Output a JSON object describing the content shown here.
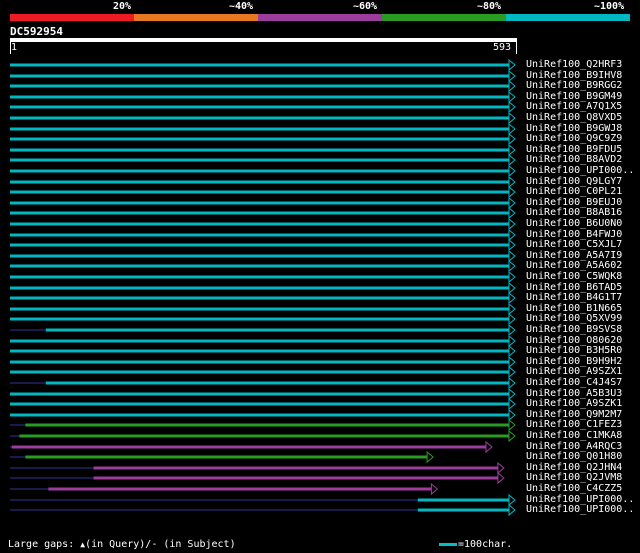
{
  "legend": {
    "labels": [
      "20%",
      "~40%",
      "~60%",
      "~80%",
      "~100%"
    ],
    "colors": [
      "#ed1c24",
      "#e87722",
      "#9c3d9e",
      "#2a9b23",
      "#00b8c2"
    ]
  },
  "query": {
    "id": "DC592954",
    "start": "1",
    "end": "593"
  },
  "hits": [
    {
      "label": "UniRef100_Q2HRF3",
      "color": "#00b8c2",
      "start": 1,
      "end": 593
    },
    {
      "label": "UniRef100_B9IHV8",
      "color": "#00b8c2",
      "start": 1,
      "end": 593
    },
    {
      "label": "UniRef100_B9RGG2",
      "color": "#00b8c2",
      "start": 1,
      "end": 593
    },
    {
      "label": "UniRef100_B9GM49",
      "color": "#00b8c2",
      "start": 1,
      "end": 593
    },
    {
      "label": "UniRef100_A7Q1X5",
      "color": "#00b8c2",
      "start": 1,
      "end": 593
    },
    {
      "label": "UniRef100_Q8VXD5",
      "color": "#00b8c2",
      "start": 1,
      "end": 593
    },
    {
      "label": "UniRef100_B9GWJ8",
      "color": "#00b8c2",
      "start": 1,
      "end": 593
    },
    {
      "label": "UniRef100_Q9C9Z9",
      "color": "#00b8c2",
      "start": 1,
      "end": 593
    },
    {
      "label": "UniRef100_B9FDU5",
      "color": "#00b8c2",
      "start": 1,
      "end": 593
    },
    {
      "label": "UniRef100_B8AVD2",
      "color": "#00b8c2",
      "start": 1,
      "end": 593
    },
    {
      "label": "UniRef100_UPI000..",
      "color": "#00b8c2",
      "start": 1,
      "end": 593
    },
    {
      "label": "UniRef100_Q9LGY7",
      "color": "#00b8c2",
      "start": 1,
      "end": 593
    },
    {
      "label": "UniRef100_C0PL21",
      "color": "#00b8c2",
      "start": 1,
      "end": 593
    },
    {
      "label": "UniRef100_B9EUJ0",
      "color": "#00b8c2",
      "start": 1,
      "end": 593
    },
    {
      "label": "UniRef100_B8AB16",
      "color": "#00b8c2",
      "start": 1,
      "end": 593
    },
    {
      "label": "UniRef100_B6U0N0",
      "color": "#00b8c2",
      "start": 1,
      "end": 593
    },
    {
      "label": "UniRef100_B4FWJ0",
      "color": "#00b8c2",
      "start": 1,
      "end": 593
    },
    {
      "label": "UniRef100_C5XJL7",
      "color": "#00b8c2",
      "start": 1,
      "end": 593
    },
    {
      "label": "UniRef100_A5A7I9",
      "color": "#00b8c2",
      "start": 1,
      "end": 593
    },
    {
      "label": "UniRef100_A5A602",
      "color": "#00b8c2",
      "start": 1,
      "end": 593
    },
    {
      "label": "UniRef100_C5WQK8",
      "color": "#00b8c2",
      "start": 1,
      "end": 593
    },
    {
      "label": "UniRef100_B6TAD5",
      "color": "#00b8c2",
      "start": 1,
      "end": 593
    },
    {
      "label": "UniRef100_B4G1T7",
      "color": "#00b8c2",
      "start": 1,
      "end": 593
    },
    {
      "label": "UniRef100_B1N665",
      "color": "#00b8c2",
      "start": 1,
      "end": 593
    },
    {
      "label": "UniRef100_Q5XV99",
      "color": "#00b8c2",
      "start": 1,
      "end": 593
    },
    {
      "label": "UniRef100_B9SVS8",
      "color": "#00b8c2",
      "start": 43,
      "end": 593
    },
    {
      "label": "UniRef100_O80620",
      "color": "#00b8c2",
      "start": 1,
      "end": 593
    },
    {
      "label": "UniRef100_B3H5R0",
      "color": "#00b8c2",
      "start": 1,
      "end": 593
    },
    {
      "label": "UniRef100_B9H9H2",
      "color": "#00b8c2",
      "start": 1,
      "end": 593
    },
    {
      "label": "UniRef100_A9SZX1",
      "color": "#00b8c2",
      "start": 1,
      "end": 593
    },
    {
      "label": "UniRef100_C4J4S7",
      "color": "#00b8c2",
      "start": 43,
      "end": 593
    },
    {
      "label": "UniRef100_A5B3U3",
      "color": "#00b8c2",
      "start": 1,
      "end": 593
    },
    {
      "label": "UniRef100_A9SZK1",
      "color": "#00b8c2",
      "start": 1,
      "end": 593
    },
    {
      "label": "UniRef100_Q9M2M7",
      "color": "#00b8c2",
      "start": 1,
      "end": 593
    },
    {
      "label": "UniRef100_C1FEZ3",
      "color": "#2a9b23",
      "start": 19,
      "end": 593
    },
    {
      "label": "UniRef100_C1MKA8",
      "color": "#2a9b23",
      "start": 12,
      "end": 593
    },
    {
      "label": "UniRef100_A4RQC3",
      "color": "#9c3d9e",
      "start": 3,
      "end": 566
    },
    {
      "label": "UniRef100_Q01H80",
      "color": "#2a9b23",
      "start": 19,
      "end": 497
    },
    {
      "label": "UniRef100_Q2JHN4",
      "color": "#9c3d9e",
      "start": 99,
      "end": 580
    },
    {
      "label": "UniRef100_Q2JVM8",
      "color": "#9c3d9e",
      "start": 99,
      "end": 580
    },
    {
      "label": "UniRef100_C4CZZ5",
      "color": "#9c3d9e",
      "start": 46,
      "end": 502
    },
    {
      "label": "UniRef100_UPI000..",
      "color": "#00b8c2",
      "start": 479,
      "end": 593
    },
    {
      "label": "UniRef100_UPI000..",
      "color": "#00b8c2",
      "start": 479,
      "end": 593
    }
  ],
  "footer": {
    "gaps_text": "Large gaps: ",
    "query_gap_text": "(in Query)/",
    "subject_gap_text": "- (in Subject)",
    "scale_text": "=100char."
  }
}
